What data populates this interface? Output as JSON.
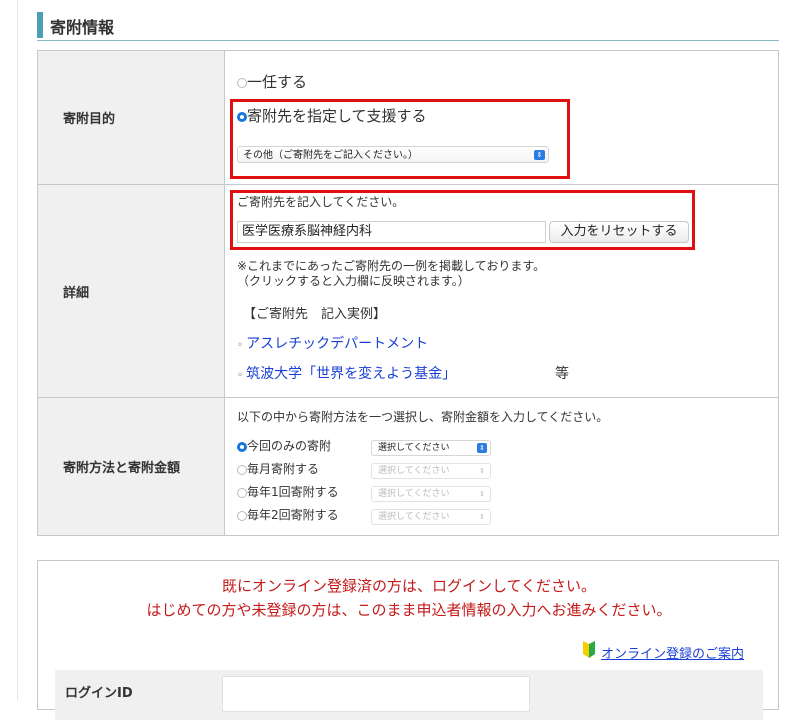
{
  "section": {
    "title": "寄附情報"
  },
  "purpose": {
    "label": "寄附目的",
    "options": [
      {
        "label": "一任する",
        "selected": false
      },
      {
        "label": "寄附先を指定して支援する",
        "selected": true
      }
    ],
    "select_value": "その他（ご寄附先をご記入ください。）"
  },
  "details": {
    "label": "詳細",
    "instruction": "ご寄附先を記入してください。",
    "input_value": "医学医療系脳神経内科",
    "reset_label": "入力をリセットする",
    "note_line1": "※これまでにあったご寄附先の一例を掲載しております。",
    "note_line2": "（クリックすると入力欄に反映されます。）",
    "examples_heading": "【ご寄附先　記入実例】",
    "examples": [
      "アスレチックデパートメント",
      "筑波大学「世界を変えよう基金」"
    ],
    "etc": "等"
  },
  "method": {
    "label": "寄附方法と寄附金額",
    "instruction": "以下の中から寄附方法を一つ選択し、寄附金額を入力してください。",
    "options": [
      {
        "label": "今回のみの寄附",
        "selected": true,
        "select_text": "選択してください",
        "enabled": true
      },
      {
        "label": "毎月寄附する",
        "selected": false,
        "select_text": "選択してください",
        "enabled": false
      },
      {
        "label": "毎年1回寄附する",
        "selected": false,
        "select_text": "選択してください",
        "enabled": false
      },
      {
        "label": "毎年2回寄附する",
        "selected": false,
        "select_text": "選択してください",
        "enabled": false
      }
    ]
  },
  "login": {
    "message_line1": "既にオンライン登録済の方は、ログインしてください。",
    "message_line2": "はじめての方や未登録の方は、このまま申込者情報の入力へお進みください。",
    "guide_link": "オンライン登録のご案内",
    "id_label": "ログインID",
    "id_value": ""
  },
  "colors": {
    "accent": "#4b9fb3",
    "highlight": "#e01010",
    "link": "#1a3fd6",
    "notice": "#c41a1a",
    "radio": "#1a75d9"
  },
  "icons": {
    "guide": "beginner-mark-icon",
    "select": "chevron-updown-icon"
  }
}
